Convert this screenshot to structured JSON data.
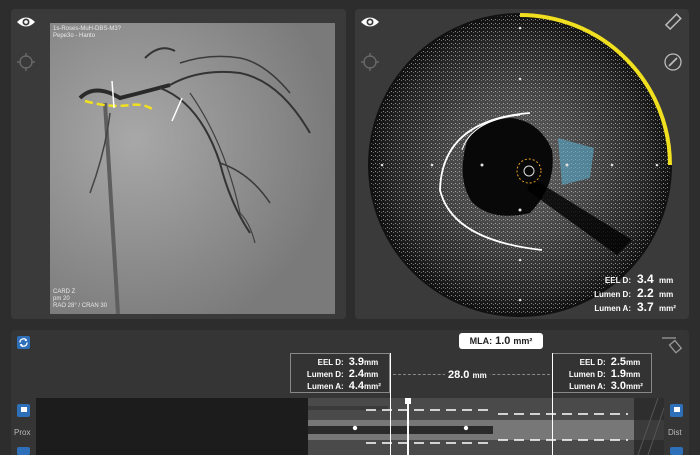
{
  "angio": {
    "caption_top": [
      "1s-Roses-MuH-DBS-M3?",
      "Pepe3o - Hanto"
    ],
    "caption_bottom": [
      "CARD Z",
      "pm 20",
      "RAO 28° / CRAN 30"
    ]
  },
  "oct": {
    "measurements": [
      {
        "label": "EEL D:",
        "value": "3.4",
        "unit": "mm"
      },
      {
        "label": "Lumen D:",
        "value": "2.2",
        "unit": "mm"
      },
      {
        "label": "Lumen A:",
        "value": "3.7",
        "unit": "mm²"
      }
    ]
  },
  "longitudinal": {
    "mla_label": "MLA:",
    "mla_value": "1.0",
    "mla_unit": "mm²",
    "left_box": [
      {
        "label": "EEL D:",
        "value": "3.9",
        "unit": "mm"
      },
      {
        "label": "Lumen D:",
        "value": "2.4",
        "unit": "mm"
      },
      {
        "label": "Lumen A:",
        "value": "4.4",
        "unit": "mm²"
      }
    ],
    "right_box": [
      {
        "label": "EEL D:",
        "value": "2.5",
        "unit": "mm"
      },
      {
        "label": "Lumen D:",
        "value": "1.9",
        "unit": "mm"
      },
      {
        "label": "Lumen A:",
        "value": "3.0",
        "unit": "mm²"
      }
    ],
    "length_value": "28.0",
    "length_unit": "mm",
    "prox_label": "Prox",
    "dist_label": "Dist"
  },
  "icons": [
    "eye-icon",
    "zoom-icon",
    "ruler-icon",
    "pen-icon",
    "refresh-icon",
    "flag-icon",
    "pin-icon"
  ],
  "colors": {
    "accent_yellow": "#f0e020",
    "button_blue": "#2e6fba",
    "lumen_teal": "#5aaacc"
  }
}
